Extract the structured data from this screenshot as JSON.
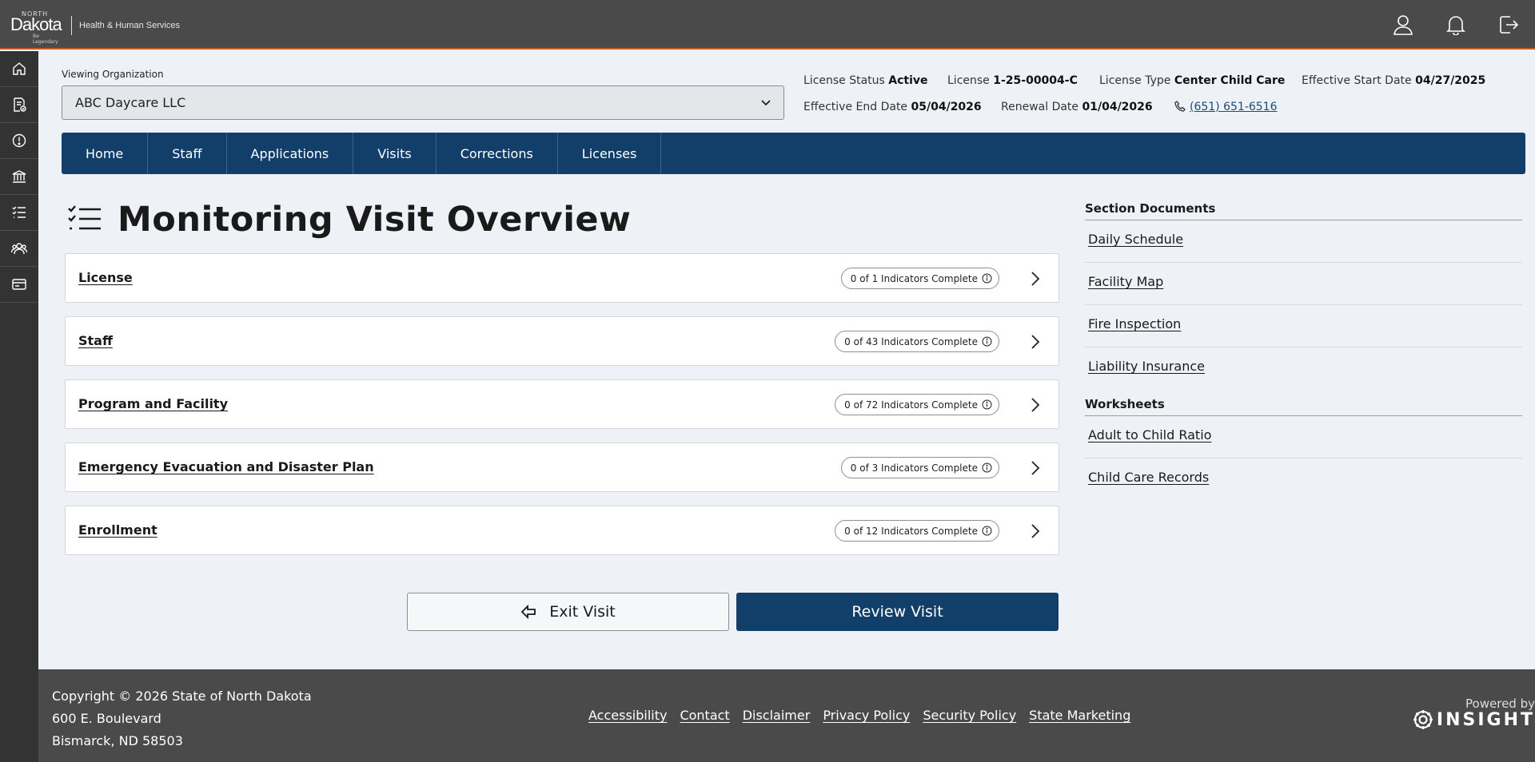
{
  "brand": {
    "north": "NORTH",
    "dakota": "Dakota",
    "tagline": "Be Legendary",
    "department": "Health & Human Services"
  },
  "top_icons": [
    "user-icon",
    "bell-icon",
    "logout-icon"
  ],
  "side_nav": [
    "home-icon",
    "document-check-icon",
    "alert-circle-icon",
    "institution-icon",
    "checklist-icon",
    "users-icon",
    "card-icon"
  ],
  "org": {
    "label": "Viewing Organization",
    "value": "ABC Daycare LLC"
  },
  "license": {
    "status_label": "License Status",
    "status_value": "Active",
    "number_label": "License",
    "number_value": "1-25-00004-C",
    "type_label": "License Type",
    "type_value": "Center Child Care",
    "start_label": "Effective Start Date",
    "start_value": "04/27/2025",
    "end_label": "Effective End Date",
    "end_value": "05/04/2026",
    "renewal_label": "Renewal Date",
    "renewal_value": "01/04/2026",
    "phone": "(651) 651-6516"
  },
  "tabs": [
    "Home",
    "Staff",
    "Applications",
    "Visits",
    "Corrections",
    "Licenses"
  ],
  "page_title": "Monitoring Visit Overview",
  "sections": [
    {
      "title": "License",
      "indicators": "0 of 1 Indicators Complete"
    },
    {
      "title": "Staff",
      "indicators": "0 of 43 Indicators Complete"
    },
    {
      "title": "Program and Facility",
      "indicators": "0 of 72 Indicators Complete"
    },
    {
      "title": "Emergency Evacuation and Disaster Plan",
      "indicators": "0 of 3 Indicators Complete"
    },
    {
      "title": "Enrollment",
      "indicators": "0 of 12 Indicators Complete"
    }
  ],
  "buttons": {
    "exit": "Exit Visit",
    "review": "Review Visit"
  },
  "section_documents": {
    "heading": "Section Documents",
    "items": [
      "Daily Schedule",
      "Facility Map",
      "Fire Inspection",
      "Liability Insurance"
    ]
  },
  "worksheets": {
    "heading": "Worksheets",
    "items": [
      "Adult to Child Ratio",
      "Child Care Records"
    ]
  },
  "footer": {
    "copyright": "Copyright © 2026 State of North Dakota",
    "address1": "600 E. Boulevard",
    "address2": "Bismarck, ND 58503",
    "links": [
      "Accessibility",
      "Contact",
      "Disclaimer",
      "Privacy Policy",
      "Security Policy",
      "State Marketing"
    ],
    "powered_by": "Powered by",
    "insight": "INSIGHT"
  },
  "colors": {
    "navy": "#123f6a",
    "topbar": "#4a4a4a",
    "sidenav": "#333333",
    "accent_line": "#c85a2a",
    "page_bg": "#eef2f6"
  }
}
